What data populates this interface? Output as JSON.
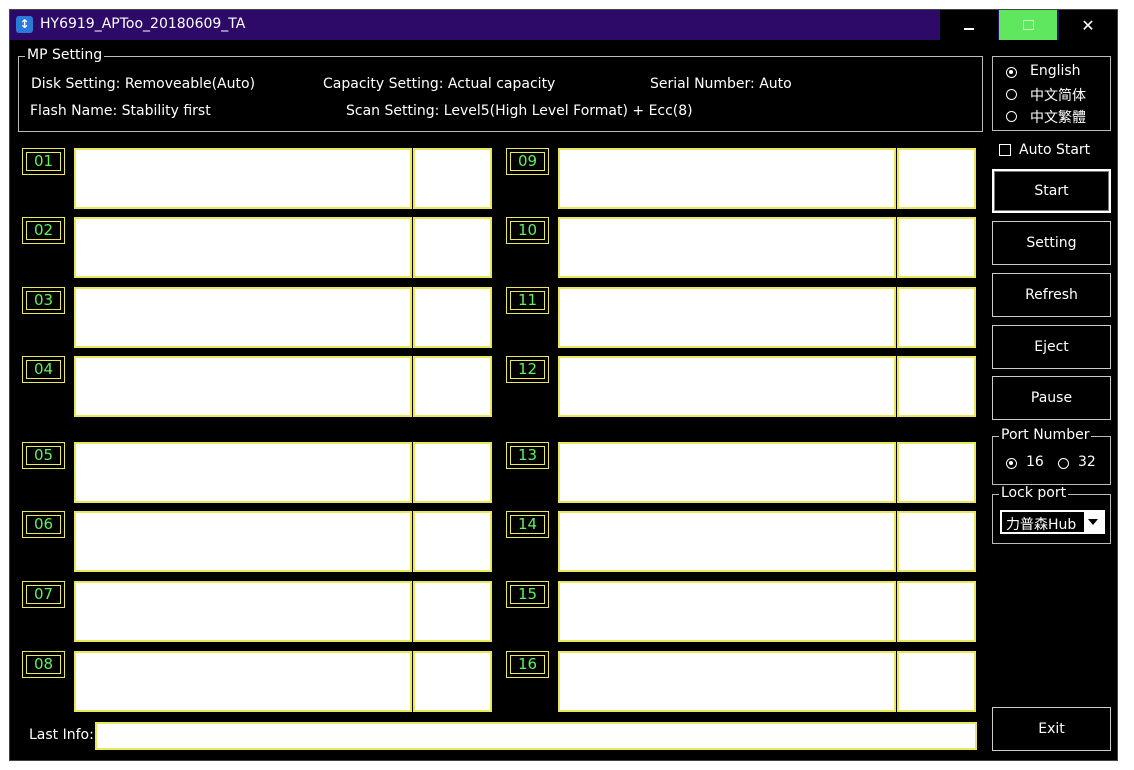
{
  "window": {
    "title": "HY6919_APToo_20180609_TA",
    "colors": {
      "titlebar": "#2e0a68",
      "maximize": "#5fe85f",
      "port_border": "#e8e85a",
      "port_label": "#5ef35e"
    }
  },
  "mp_setting": {
    "legend": "MP Setting",
    "disk_setting": "Disk Setting: Removeable(Auto)",
    "capacity_setting": "Capacity Setting: Actual capacity",
    "serial_number": "Serial Number:  Auto",
    "flash_name": "Flash Name: Stability first",
    "scan_setting": "Scan Setting: Level5(High Level Format) + Ecc(8)"
  },
  "language": {
    "options": [
      "English",
      "中文简体",
      "中文繁體"
    ],
    "selected": "English"
  },
  "auto_start": {
    "label": "Auto Start",
    "checked": false
  },
  "buttons": {
    "start": "Start",
    "setting": "Setting",
    "refresh": "Refresh",
    "eject": "Eject",
    "pause": "Pause",
    "exit": "Exit"
  },
  "port_number": {
    "legend": "Port Number",
    "options": [
      "16",
      "32"
    ],
    "selected": "16"
  },
  "lock_port": {
    "legend": "Lock port",
    "selected": "力普森Hub"
  },
  "ports": [
    "01",
    "02",
    "03",
    "04",
    "05",
    "06",
    "07",
    "08",
    "09",
    "10",
    "11",
    "12",
    "13",
    "14",
    "15",
    "16"
  ],
  "last_info": {
    "label": "Last Info:",
    "value": ""
  }
}
